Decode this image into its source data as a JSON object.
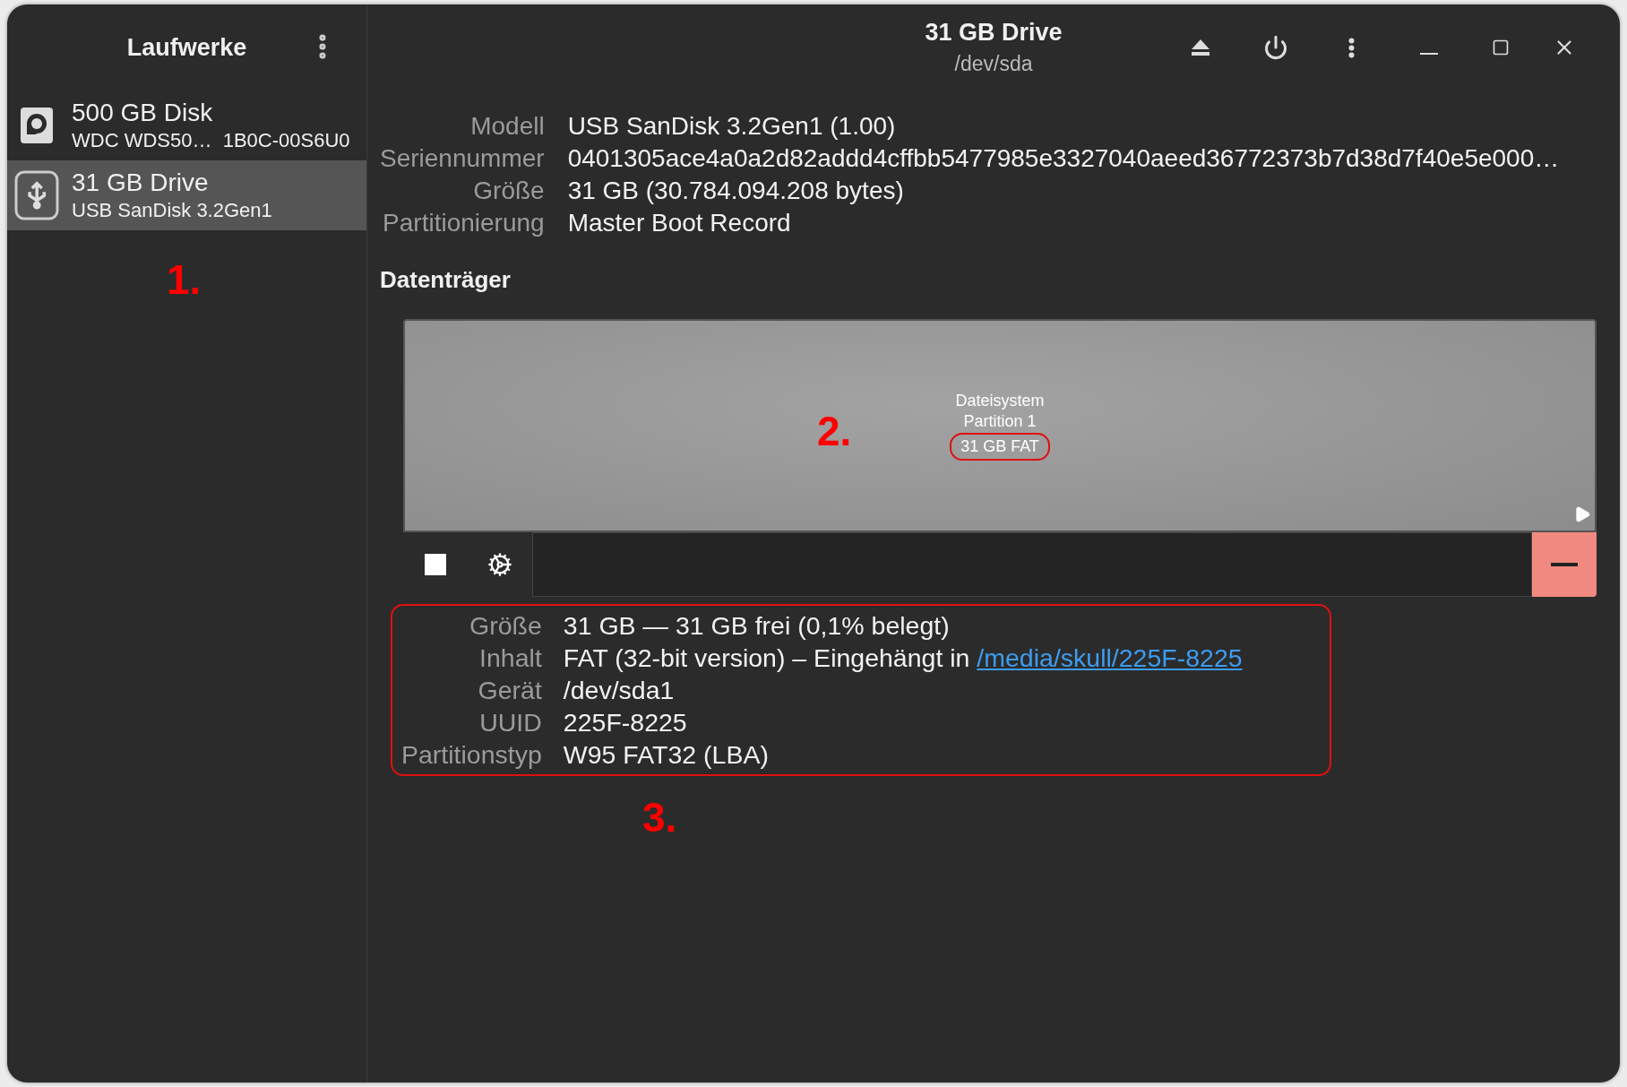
{
  "sidebar": {
    "title": "Laufwerke",
    "items": [
      {
        "kind": "disk",
        "title": "500 GB Disk",
        "subtitle": "WDC WDS50…  1B0C-00S6U0",
        "selected": false
      },
      {
        "kind": "usb",
        "title": "31 GB Drive",
        "subtitle": "USB SanDisk 3.2Gen1",
        "selected": true
      }
    ]
  },
  "header": {
    "title": "31 GB Drive",
    "subtitle": "/dev/sda"
  },
  "details": [
    {
      "label": "Modell",
      "value": "USB SanDisk 3.2Gen1 (1.00)"
    },
    {
      "label": "Seriennummer",
      "value": "0401305ace4a0a2d82addd4cffbb5477985e3327040aeed36772373b7d38d7f40e5e000…"
    },
    {
      "label": "Größe",
      "value": "31 GB (30.784.094.208 bytes)"
    },
    {
      "label": "Partitionierung",
      "value": "Master Boot Record"
    }
  ],
  "volumes": {
    "heading": "Datenträger",
    "partition": {
      "lines": [
        "Dateisystem",
        "Partition 1"
      ],
      "size": "31 GB FAT",
      "size_highlighted": true,
      "selected": false
    },
    "info_highlighted": true,
    "info": [
      {
        "label": "Größe",
        "value": "31 GB — 31 GB frei (0,1% belegt)"
      },
      {
        "label": "Inhalt",
        "value": "FAT (32-bit version) – Eingehängt in ",
        "link": "/media/skull/225F-8225"
      },
      {
        "label": "Gerät",
        "value": "/dev/sda1"
      },
      {
        "label": "UUID",
        "value": "225F-8225"
      },
      {
        "label": "Partitionstyp",
        "value": "W95 FAT32 (LBA)"
      }
    ]
  },
  "annotations": [
    "1.",
    "2.",
    "3."
  ]
}
